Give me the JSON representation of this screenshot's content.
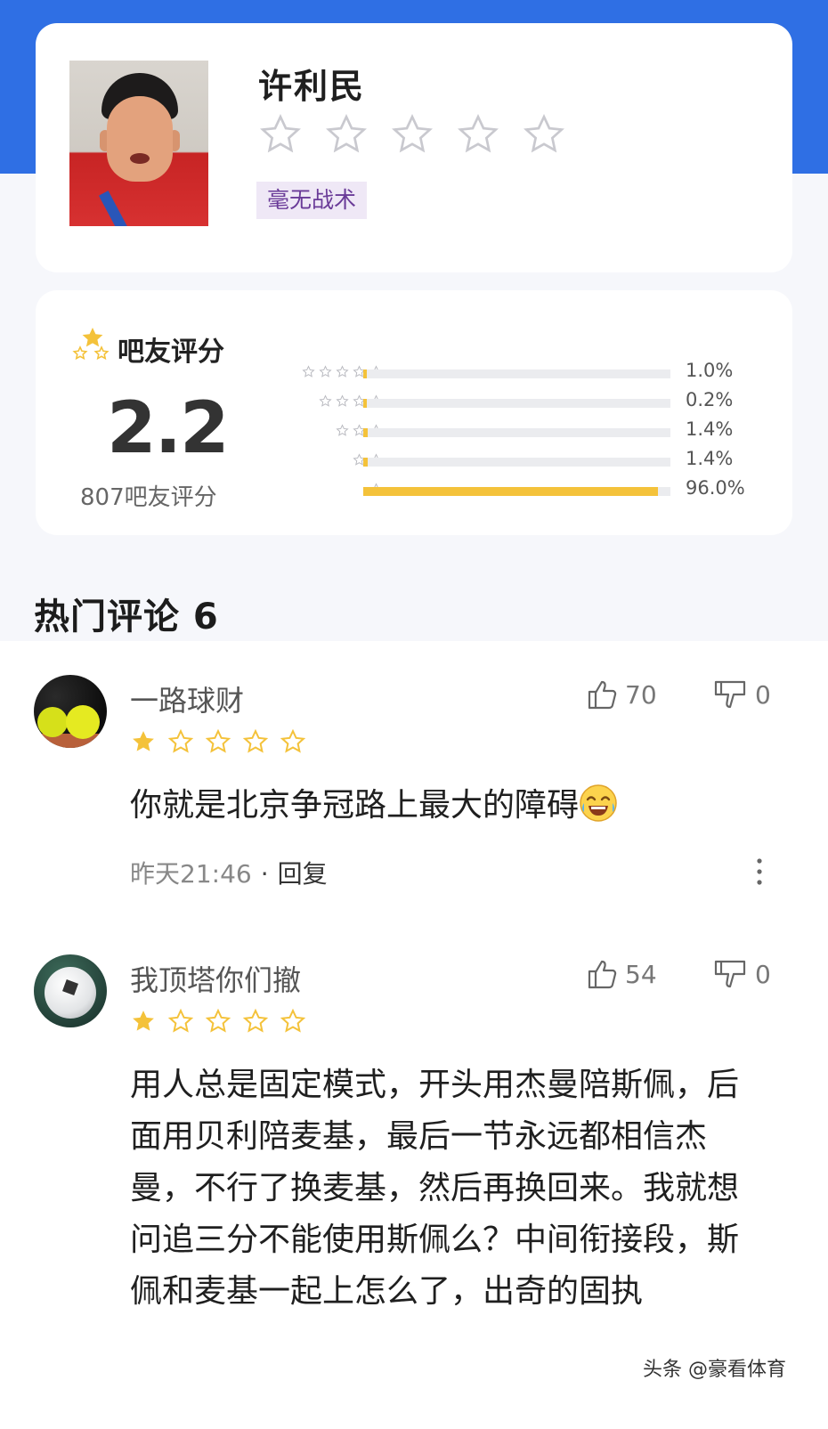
{
  "profile": {
    "name": "许利民",
    "rating_stars_filled": 0,
    "rating_stars_total": 5,
    "tag": "毫无战术"
  },
  "rating": {
    "title": "吧友评分",
    "score": "2.2",
    "count_text": "807吧友评分",
    "distribution": [
      {
        "stars": 5,
        "percent_text": "1.0%",
        "percent": 1.0
      },
      {
        "stars": 4,
        "percent_text": "0.2%",
        "percent": 0.2
      },
      {
        "stars": 3,
        "percent_text": "1.4%",
        "percent": 1.4
      },
      {
        "stars": 2,
        "percent_text": "1.4%",
        "percent": 1.4
      },
      {
        "stars": 1,
        "percent_text": "96.0%",
        "percent": 96.0
      }
    ]
  },
  "comments_section": {
    "title": "热门评论 6"
  },
  "comments": [
    {
      "username": "一路球财",
      "stars_filled": 1,
      "likes": "70",
      "dislikes": "0",
      "text": "你就是北京争冠路上最大的障碍",
      "time": "昨天21:46",
      "separator": "·",
      "reply_label": "回复"
    },
    {
      "username": "我顶塔你们撤",
      "stars_filled": 1,
      "likes": "54",
      "dislikes": "0",
      "text": "用人总是固定模式，开头用杰曼陪斯佩，后面用贝利陪麦基，最后一节永远都相信杰曼，不行了换麦基，然后再换回来。我就想问追三分不能使用斯佩么？中间衔接段，斯佩和麦基一起上怎么了，出奇的固执"
    }
  ],
  "watermark": "头条 @豪看体育",
  "colors": {
    "header_blue": "#2f6fe4",
    "star_gold": "#f4c23a",
    "tag_bg": "#efe8f6",
    "tag_text": "#6a3b98"
  }
}
